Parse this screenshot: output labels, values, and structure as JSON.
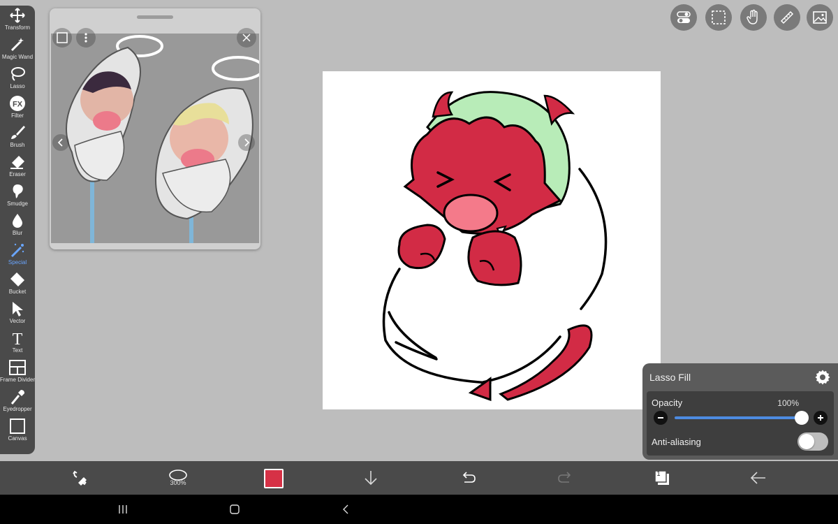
{
  "toolbar": {
    "tools": [
      {
        "label": "Transform",
        "icon": "transform-icon"
      },
      {
        "label": "Magic Wand",
        "icon": "magic-wand-icon"
      },
      {
        "label": "Lasso",
        "icon": "lasso-icon"
      },
      {
        "label": "Filter",
        "icon": "fx-icon"
      },
      {
        "label": "Brush",
        "icon": "brush-icon"
      },
      {
        "label": "Eraser",
        "icon": "eraser-icon"
      },
      {
        "label": "Smudge",
        "icon": "smudge-icon"
      },
      {
        "label": "Blur",
        "icon": "blur-drop-icon"
      },
      {
        "label": "Special",
        "icon": "special-wand-icon",
        "active": true
      },
      {
        "label": "Bucket",
        "icon": "bucket-icon"
      },
      {
        "label": "Vector",
        "icon": "vector-arrow-icon"
      },
      {
        "label": "Text",
        "icon": "text-icon"
      },
      {
        "label": "Frame Divider",
        "icon": "frame-divider-icon"
      },
      {
        "label": "Eyedropper",
        "icon": "eyedropper-icon"
      },
      {
        "label": "Canvas",
        "icon": "canvas-icon"
      }
    ],
    "fx_glyph": "FX",
    "text_glyph": "T"
  },
  "top_right": [
    "toggle-icon",
    "selection-icon",
    "hand-icon",
    "ruler-icon",
    "image-icon"
  ],
  "panel": {
    "title": "Lasso Fill",
    "opacity_label": "Opacity",
    "opacity_value": "100%",
    "opacity_fraction": 1.0,
    "anti_aliasing_label": "Anti-aliasing",
    "anti_aliasing_on": false
  },
  "bottom_bar": {
    "brush_size_text": "300%",
    "layer_count": "1",
    "primary_color": "#d63146"
  },
  "colors": {
    "devil_red": "#d22b45",
    "hair_green": "#b8ecb8",
    "mouth_pink": "#f47a8a",
    "slider_blue": "#4d8be0"
  }
}
